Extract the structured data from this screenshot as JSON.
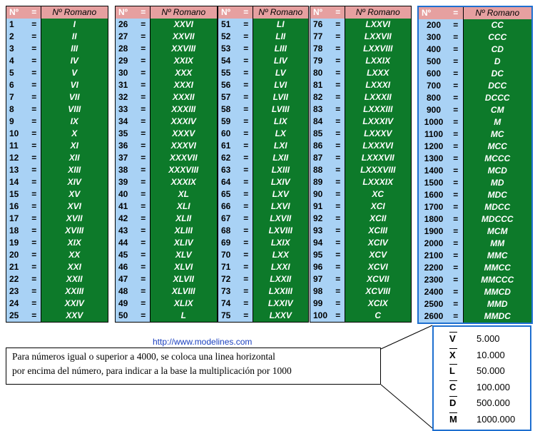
{
  "headers": {
    "num": "Nº",
    "eq": "=",
    "rom": "Nº Romano"
  },
  "tables": [
    {
      "rows": [
        [
          "1",
          "I"
        ],
        [
          "2",
          "II"
        ],
        [
          "3",
          "III"
        ],
        [
          "4",
          "IV"
        ],
        [
          "5",
          "V"
        ],
        [
          "6",
          "VI"
        ],
        [
          "7",
          "VII"
        ],
        [
          "8",
          "VIII"
        ],
        [
          "9",
          "IX"
        ],
        [
          "10",
          "X"
        ],
        [
          "11",
          "XI"
        ],
        [
          "12",
          "XII"
        ],
        [
          "13",
          "XIII"
        ],
        [
          "14",
          "XIV"
        ],
        [
          "15",
          "XV"
        ],
        [
          "16",
          "XVI"
        ],
        [
          "17",
          "XVII"
        ],
        [
          "18",
          "XVIII"
        ],
        [
          "19",
          "XIX"
        ],
        [
          "20",
          "XX"
        ],
        [
          "21",
          "XXI"
        ],
        [
          "22",
          "XXII"
        ],
        [
          "23",
          "XXIII"
        ],
        [
          "24",
          "XXIV"
        ],
        [
          "25",
          "XXV"
        ]
      ]
    },
    {
      "rows": [
        [
          "26",
          "XXVI"
        ],
        [
          "27",
          "XXVII"
        ],
        [
          "28",
          "XXVIII"
        ],
        [
          "29",
          "XXIX"
        ],
        [
          "30",
          "XXX"
        ],
        [
          "31",
          "XXXI"
        ],
        [
          "32",
          "XXXII"
        ],
        [
          "33",
          "XXXIII"
        ],
        [
          "34",
          "XXXIV"
        ],
        [
          "35",
          "XXXV"
        ],
        [
          "36",
          "XXXVI"
        ],
        [
          "37",
          "XXXVII"
        ],
        [
          "38",
          "XXXVIII"
        ],
        [
          "39",
          "XXXIX"
        ],
        [
          "40",
          "XL"
        ],
        [
          "41",
          "XLI"
        ],
        [
          "42",
          "XLII"
        ],
        [
          "43",
          "XLIII"
        ],
        [
          "44",
          "XLIV"
        ],
        [
          "45",
          "XLV"
        ],
        [
          "46",
          "XLVI"
        ],
        [
          "47",
          "XLVII"
        ],
        [
          "48",
          "XLVIII"
        ],
        [
          "49",
          "XLIX"
        ],
        [
          "50",
          "L"
        ]
      ]
    },
    {
      "rows": [
        [
          "51",
          "LI"
        ],
        [
          "52",
          "LII"
        ],
        [
          "53",
          "LIII"
        ],
        [
          "54",
          "LIV"
        ],
        [
          "55",
          "LV"
        ],
        [
          "56",
          "LVI"
        ],
        [
          "57",
          "LVII"
        ],
        [
          "58",
          "LVIII"
        ],
        [
          "59",
          "LIX"
        ],
        [
          "60",
          "LX"
        ],
        [
          "61",
          "LXI"
        ],
        [
          "62",
          "LXII"
        ],
        [
          "63",
          "LXIII"
        ],
        [
          "64",
          "LXIV"
        ],
        [
          "65",
          "LXV"
        ],
        [
          "66",
          "LXVI"
        ],
        [
          "67",
          "LXVII"
        ],
        [
          "68",
          "LXVIII"
        ],
        [
          "69",
          "LXIX"
        ],
        [
          "70",
          "LXX"
        ],
        [
          "71",
          "LXXI"
        ],
        [
          "72",
          "LXXII"
        ],
        [
          "73",
          "LXXIII"
        ],
        [
          "74",
          "LXXIV"
        ],
        [
          "75",
          "LXXV"
        ]
      ]
    },
    {
      "rows": [
        [
          "76",
          "LXXVI"
        ],
        [
          "77",
          "LXXVII"
        ],
        [
          "78",
          "LXXVIII"
        ],
        [
          "79",
          "LXXIX"
        ],
        [
          "80",
          "LXXX"
        ],
        [
          "81",
          "LXXXI"
        ],
        [
          "82",
          "LXXXII"
        ],
        [
          "83",
          "LXXXIII"
        ],
        [
          "84",
          "LXXXIV"
        ],
        [
          "85",
          "LXXXV"
        ],
        [
          "86",
          "LXXXVI"
        ],
        [
          "87",
          "LXXXVII"
        ],
        [
          "88",
          "LXXXVIII"
        ],
        [
          "89",
          "LXXXIX"
        ],
        [
          "90",
          "XC"
        ],
        [
          "91",
          "XCI"
        ],
        [
          "92",
          "XCII"
        ],
        [
          "93",
          "XCIII"
        ],
        [
          "94",
          "XCIV"
        ],
        [
          "95",
          "XCV"
        ],
        [
          "96",
          "XCVI"
        ],
        [
          "97",
          "XCVII"
        ],
        [
          "98",
          "XCVIII"
        ],
        [
          "99",
          "XCIX"
        ],
        [
          "100",
          "C"
        ]
      ]
    },
    {
      "rows": [
        [
          "200",
          "CC"
        ],
        [
          "300",
          "CCC"
        ],
        [
          "400",
          "CD"
        ],
        [
          "500",
          "D"
        ],
        [
          "600",
          "DC"
        ],
        [
          "700",
          "DCC"
        ],
        [
          "800",
          "DCCC"
        ],
        [
          "900",
          "CM"
        ],
        [
          "1000",
          "M"
        ],
        [
          "1100",
          "MC"
        ],
        [
          "1200",
          "MCC"
        ],
        [
          "1300",
          "MCCC"
        ],
        [
          "1400",
          "MCD"
        ],
        [
          "1500",
          "MD"
        ],
        [
          "1600",
          "MDC"
        ],
        [
          "1700",
          "MDCC"
        ],
        [
          "1800",
          "MDCCC"
        ],
        [
          "1900",
          "MCM"
        ],
        [
          "2000",
          "MM"
        ],
        [
          "2100",
          "MMC"
        ],
        [
          "2200",
          "MMCC"
        ],
        [
          "2300",
          "MMCCC"
        ],
        [
          "2400",
          "MMCD"
        ],
        [
          "2500",
          "MMD"
        ],
        [
          "2600",
          "MMDC"
        ]
      ]
    }
  ],
  "link": "http://www.modelines.com",
  "callout": {
    "line1": "Para números igual o superior a 4000, se coloca una linea horizontal",
    "line2": "por encima del número, para indicar a la base la multiplicación por 1000"
  },
  "big_numbers": [
    {
      "sym": "V",
      "val": "5.000"
    },
    {
      "sym": "X",
      "val": "10.000"
    },
    {
      "sym": "L",
      "val": "50.000"
    },
    {
      "sym": "C",
      "val": "100.000"
    },
    {
      "sym": "D",
      "val": "500.000"
    },
    {
      "sym": "M",
      "val": "1000.000"
    }
  ],
  "colors": {
    "header": "#e6a0a0",
    "number_col": "#a9d2f5",
    "roman_col": "#0d7a2a",
    "accent_border": "#1e6fd0"
  }
}
